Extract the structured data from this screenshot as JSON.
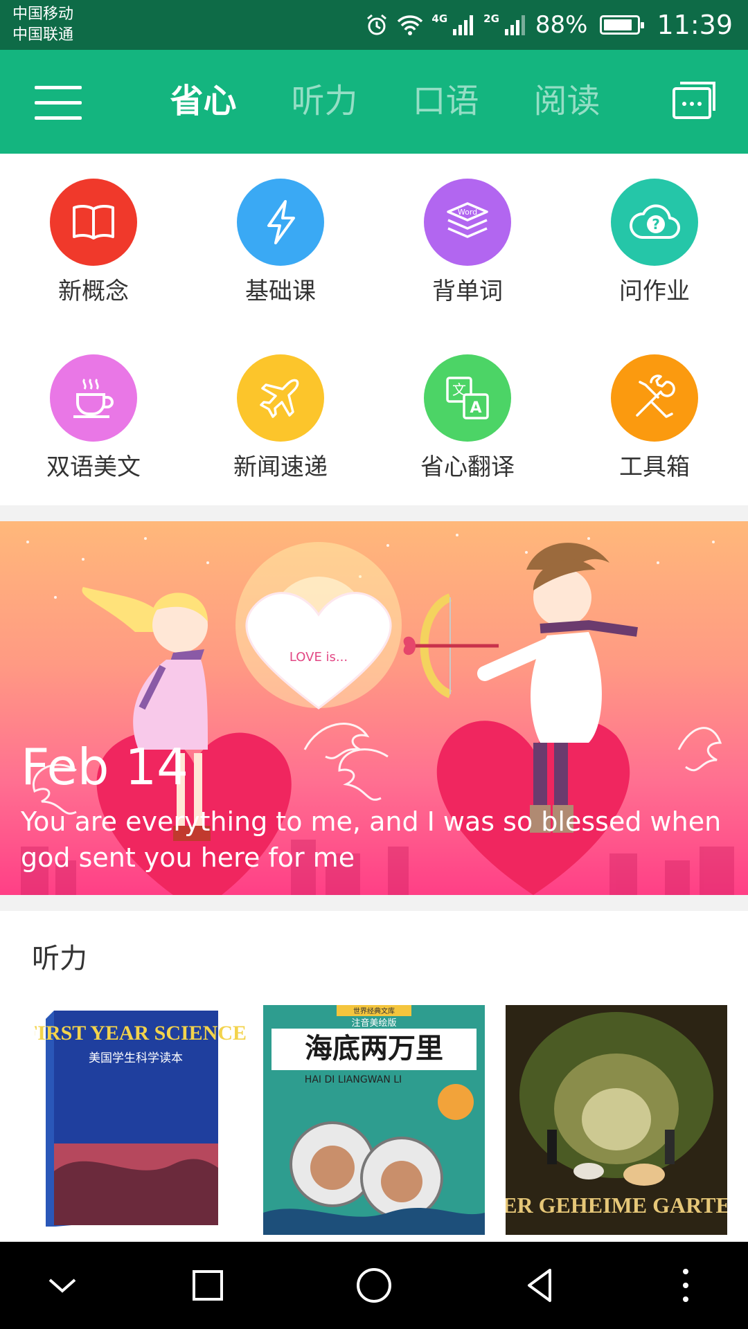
{
  "status_bar": {
    "carrier_1": "中国移动",
    "carrier_2": "中国联通",
    "net_1": "4G",
    "net_2": "2G",
    "battery": "88%",
    "battery_level": 0.88,
    "time": "11:39"
  },
  "app_bar": {
    "tabs": [
      {
        "label": "省心",
        "active": true
      },
      {
        "label": "听力",
        "active": false
      },
      {
        "label": "口语",
        "active": false
      },
      {
        "label": "阅读",
        "active": false
      }
    ],
    "menu_icon": "hamburger-icon",
    "message_icon": "chat-icon"
  },
  "grid": [
    {
      "label": "新概念",
      "color": "#f0392b",
      "icon": "book-icon"
    },
    {
      "label": "基础课",
      "color": "#3aa9f4",
      "icon": "lightning-icon"
    },
    {
      "label": "背单词",
      "color": "#b266f0",
      "icon": "word-stack-icon"
    },
    {
      "label": "问作业",
      "color": "#25c6a8",
      "icon": "question-cloud-icon"
    },
    {
      "label": "双语美文",
      "color": "#e977e6",
      "icon": "coffee-icon"
    },
    {
      "label": "新闻速递",
      "color": "#fcc52b",
      "icon": "airplane-icon"
    },
    {
      "label": "省心翻译",
      "color": "#4cd466",
      "icon": "translate-icon"
    },
    {
      "label": "工具箱",
      "color": "#fb9a0f",
      "icon": "tools-icon"
    }
  ],
  "banner": {
    "heart_text": "LOVE is...",
    "date": "Feb 14",
    "quote": "You are everything to me, and I was so blessed when god sent you here for me"
  },
  "listening": {
    "title": "听力",
    "books": [
      {
        "title": "FIRST YEAR SCIENCE",
        "subtitle": "美国学生科学读本"
      },
      {
        "title": "海底两万里",
        "subtitle": "HAI DI LIANGWAN LI",
        "series": "世界经典文库",
        "edition": "注音美绘版"
      },
      {
        "title": "DER GEHEIME GARTEN"
      }
    ]
  },
  "nav_bar": {
    "icons": [
      "chevron-down-icon",
      "recent-apps-icon",
      "home-icon",
      "back-icon",
      "more-icon"
    ]
  }
}
